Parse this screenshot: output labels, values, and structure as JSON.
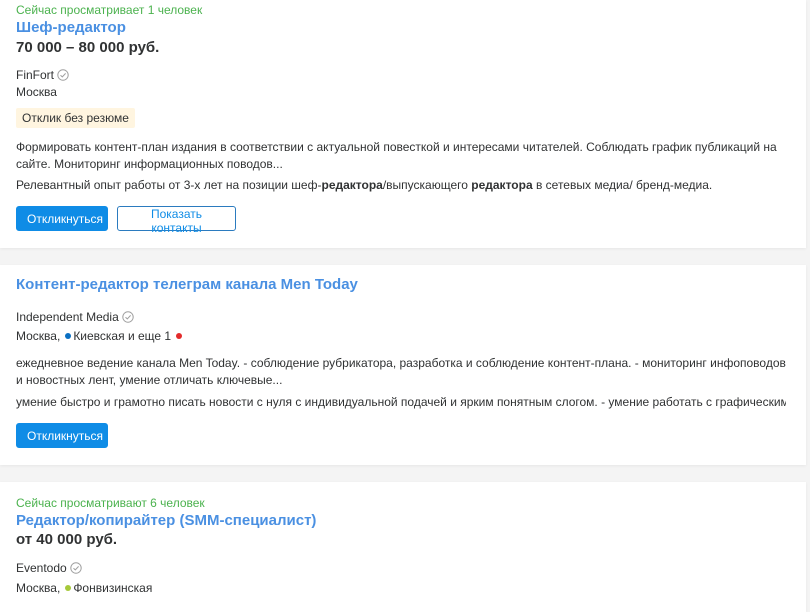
{
  "colors": {
    "accent": "#0f8ce6",
    "title": "#4a90e2",
    "viewing": "#4bb24e",
    "badge_bg": "#fff5e0",
    "metro_blue": "#0a6fc2",
    "metro_red": "#e32b2b",
    "metro_green": "#a6c93a"
  },
  "vacancies": [
    {
      "viewing": "Сейчас просматривает 1 человек",
      "title": "Шеф-редактор",
      "salary": "70 000 – 80 000 руб.",
      "company": "FinFort",
      "city": "Москва",
      "badge": "Отклик без резюме",
      "description": "Формировать контент-план издания в соответствии с актуальной повесткой и интересами читателей. Соблюдать график публикаций на сайте. Мониторинг информационных поводов...",
      "requirements_parts": [
        "Релевантный опыт работы от 3-х лет на позиции шеф-",
        "редактора",
        "/выпускающего ",
        "редактора",
        " в сетевых медиа/ бренд-медиа."
      ],
      "respond_label": "Откликнуться",
      "contacts_label": "Показать контакты"
    },
    {
      "title": "Контент-редактор телеграм канала Men Today",
      "company": "Independent Media",
      "city": "Москва,",
      "metro": "Киевская и еще 1",
      "description": "ежедневное ведение канала Men Today. - соблюдение рубрикатора, разработка и соблюдение контент-плана. - мониторинг инфоповодов и новостных лент, умение отличать ключевые...",
      "requirements": "умение быстро и грамотно писать новости с нуля с индивидуальной подачей и ярким понятным слогом. - умение работать с графическими и...",
      "respond_label": "Откликнуться"
    },
    {
      "viewing": "Сейчас просматривают 6 человек",
      "title": "Редактор/копирайтер (SMM-специалист)",
      "salary": "от 40 000 руб.",
      "company": "Eventodo",
      "city": "Москва,",
      "metro": "Фонвизинская"
    }
  ]
}
